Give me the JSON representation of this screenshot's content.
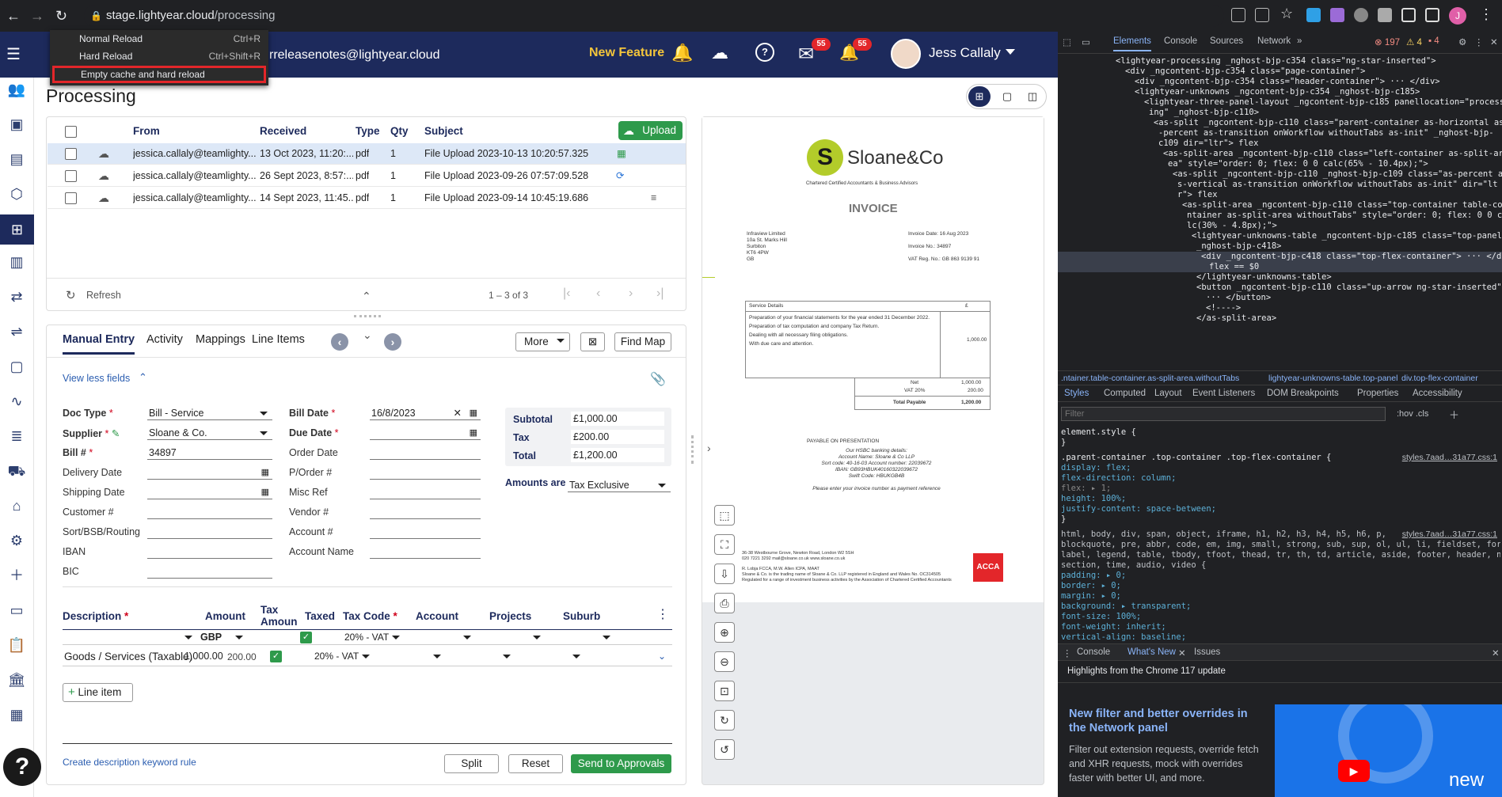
{
  "browser": {
    "url_host": "stage.lightyear.cloud",
    "url_path": "/processing",
    "avatar_initial": "J",
    "reload_menu": [
      {
        "label": "Normal Reload",
        "shortcut": "Ctrl+R"
      },
      {
        "label": "Hard Reload",
        "shortcut": "Ctrl+Shift+R"
      },
      {
        "label": "Empty cache and hard reload",
        "shortcut": ""
      }
    ]
  },
  "header": {
    "email_partial": "rreleasenotes@lightyear.cloud",
    "new_feature": "New Feature",
    "mail_count": "55",
    "notif_count": "55",
    "user_name": "Jess Callaly"
  },
  "page": {
    "title": "Processing"
  },
  "table": {
    "headers": [
      "From",
      "Received",
      "Type",
      "Qty",
      "Subject"
    ],
    "upload_label": "Upload",
    "rows": [
      {
        "from": "jessica.callaly@teamlighty...",
        "received": "13 Oct 2023, 11:20:...",
        "type": "pdf",
        "qty": "1",
        "subject": "File Upload 2023-10-13 10:20:57.325"
      },
      {
        "from": "jessica.callaly@teamlighty...",
        "received": "26 Sept 2023, 8:57:...",
        "type": "pdf",
        "qty": "1",
        "subject": "File Upload 2023-09-26 07:57:09.528"
      },
      {
        "from": "jessica.callaly@teamlighty...",
        "received": "14 Sept 2023, 11:45...",
        "type": "pdf",
        "qty": "1",
        "subject": "File Upload 2023-09-14 10:45:19.686"
      }
    ],
    "refresh_label": "Refresh",
    "pagination": "1 – 3 of 3"
  },
  "entry": {
    "tabs": [
      "Manual Entry",
      "Activity",
      "Mappings",
      "Line Items"
    ],
    "more_label": "More",
    "find_map_label": "Find Map",
    "view_less": "View less fields",
    "fields_left": [
      {
        "label": "Doc Type",
        "required": true,
        "value": "Bill - Service"
      },
      {
        "label": "Supplier",
        "required": true,
        "value": "Sloane & Co."
      },
      {
        "label": "Bill #",
        "required": true,
        "value": "34897"
      },
      {
        "label": "Delivery Date",
        "required": false,
        "value": ""
      },
      {
        "label": "Shipping Date",
        "required": false,
        "value": ""
      },
      {
        "label": "Customer #",
        "required": false,
        "value": ""
      },
      {
        "label": "Sort/BSB/Routing",
        "required": false,
        "value": ""
      },
      {
        "label": "IBAN",
        "required": false,
        "value": ""
      },
      {
        "label": "BIC",
        "required": false,
        "value": ""
      }
    ],
    "fields_mid": [
      {
        "label": "Bill Date",
        "required": true,
        "value": "16/8/2023"
      },
      {
        "label": "Due Date",
        "required": true,
        "value": ""
      },
      {
        "label": "Order Date",
        "required": false,
        "value": ""
      },
      {
        "label": "P/Order #",
        "required": false,
        "value": ""
      },
      {
        "label": "Misc Ref",
        "required": false,
        "value": ""
      },
      {
        "label": "Vendor #",
        "required": false,
        "value": ""
      },
      {
        "label": "Account #",
        "required": false,
        "value": ""
      },
      {
        "label": "Account Name",
        "required": false,
        "value": ""
      }
    ],
    "totals": [
      {
        "label": "Subtotal",
        "value": "£1,000.00"
      },
      {
        "label": "Tax",
        "value": "£200.00"
      },
      {
        "label": "Total",
        "value": "£1,200.00"
      }
    ],
    "amounts_are_label": "Amounts are",
    "amounts_are_value": "Tax Exclusive",
    "line_headers": {
      "description": "Description",
      "amount": "Amount",
      "tax_amount": "Tax Amoun",
      "taxed": "Taxed",
      "tax_code": "Tax Code",
      "account": "Account",
      "projects": "Projects",
      "suburb": "Suburb"
    },
    "currency": "GBP",
    "filter_tax_code": "20% - VAT",
    "line": {
      "description": "Goods / Services (Taxable)",
      "amount": "1,000.00",
      "tax_amount": "200.00",
      "tax_code": "20% - VAT"
    },
    "add_line_label": "Line item",
    "keyword_rule_link": "Create description keyword rule",
    "split_label": "Split",
    "reset_label": "Reset",
    "send_label": "Send to Approvals"
  },
  "invoice": {
    "company": "Sloane&Co",
    "tagline": "Chartered Certified Accountants & Business Advisors",
    "title": "INVOICE",
    "address": [
      "Infraview Limited",
      "10a St. Marks Hill",
      "Surbiton",
      "KT6 4PW",
      "GB"
    ],
    "invoice_date": "Invoice Date:  16 Aug 2023",
    "invoice_no": "Invoice No.:    34897",
    "vat_reg": "VAT Reg. No.:  GB 863 9139 91",
    "service_header": "Service Details",
    "currency_symbol": "£",
    "services": [
      "Preparation of your financial statements for the year ended 31 December 2022.",
      "Preparation of tax computation and company Tax Return.",
      "Dealing with all necessary filing obligations.",
      "With due care and attention."
    ],
    "service_amount": "1,000.00",
    "net_label": "Net",
    "net": "1,000.00",
    "vat_label": "VAT 20%",
    "vat": "200.00",
    "total_label": "Total Payable",
    "total": "1,200.00",
    "payable": "PAYABLE ON PRESENTATION",
    "bank_lines": [
      "Our HSBC banking details:",
      "Account Name: Sloane & Co LLP",
      "Sort code: 40-16-03  Account number: 22039672",
      "IBAN: GB93HBUK40160322039672",
      "Swift Code: HBUKGB4B"
    ],
    "ref_note": "Please enter your invoice number as payment reference",
    "footer_address": "36-38 Westbourne Grove, Newton Road, London W2 5SH",
    "footer_contact": "020 7221 3292   mail@sloane.co.uk   www.sloane.co.uk",
    "footer_partners": "R. Lobja FCCA, M.W. Allen ICPA, MAAT",
    "footer_reg": "Sloane & Co. is the trading name of Sloane & Co. LLP registered in England and Wales No. OC314505",
    "footer_reg2": "Regulated for a range of investment business activities by the Association of Chartered Certified Accountants",
    "acca": "ACCA"
  },
  "devtools": {
    "tabs": [
      "Elements",
      "Console",
      "Sources",
      "Network"
    ],
    "errors": "197",
    "warnings": "4",
    "issues": "4",
    "dom_lines": [
      "<lightyear-processing _nghost-bjp-c354 class=\"ng-star-inserted\">",
      "<div _ngcontent-bjp-c354 class=\"page-container\">",
      "<div _ngcontent-bjp-c354 class=\"header-container\"> ··· </div>",
      "<lightyear-unknowns _ngcontent-bjp-c354 _nghost-bjp-c185>",
      "<lightyear-three-panel-layout _ngcontent-bjp-c185 panellocation=\"process",
      "ing\" _nghost-bjp-c110>",
      "<as-split _ngcontent-bjp-c110 class=\"parent-container as-horizontal as",
      "-percent as-transition onWorkflow withoutTabs as-init\" _nghost-bjp-",
      "c109 dir=\"ltr\"> flex",
      "<as-split-area _ngcontent-bjp-c110 class=\"left-container as-split-ar",
      "ea\" style=\"order: 0; flex: 0 0 calc(65% - 10.4px);\">",
      "<as-split _ngcontent-bjp-c110 _nghost-bjp-c109 class=\"as-percent a",
      "s-vertical as-transition onWorkflow withoutTabs as-init\" dir=\"lt",
      "r\"> flex",
      "<as-split-area _ngcontent-bjp-c110 class=\"top-container table-co",
      "ntainer as-split-area withoutTabs\" style=\"order: 0; flex: 0 0 ca",
      "lc(30% - 4.8px);\">",
      "<lightyear-unknowns-table _ngcontent-bjp-c185 class=\"top-panel\"",
      "_nghost-bjp-c418>",
      "<div _ngcontent-bjp-c418 class=\"top-flex-container\"> ··· </div>",
      "flex  == $0",
      "</lightyear-unknowns-table>",
      "<button _ngcontent-bjp-c110 class=\"up-arrow ng-star-inserted\">",
      "··· </button>",
      "<!---->",
      "</as-split-area>"
    ],
    "breadcrumb": [
      ".ntainer.table-container.as-split-area.withoutTabs",
      "lightyear-unknowns-table.top-panel",
      "div.top-flex-container"
    ],
    "style_tabs": [
      "Styles",
      "Computed",
      "Layout",
      "Event Listeners",
      "DOM Breakpoints",
      "Properties",
      "Accessibility"
    ],
    "filter_placeholder": "Filter",
    "hov_cls": ":hov  .cls",
    "css_lines": [
      "element.style {",
      "}",
      ".parent-container .top-container .top-flex-container {",
      "  display: flex;",
      "  flex-direction: column;",
      "  flex: ▸ 1;",
      "  height: 100%;",
      "  justify-content: space-between;",
      "}",
      "html, body, div, span, object, iframe, h1, h2, h3, h4, h5, h6, p,",
      "blockquote, pre, abbr, code, em, img, small, strong, sub, sup, ol, ul, li, fieldset, form,",
      "label, legend, table, tbody, tfoot, thead, tr, th, td, article, aside, footer, header, nav,",
      "section, time, audio, video {",
      "  padding: ▸ 0;",
      "  border: ▸ 0;",
      "  margin: ▸ 0;",
      "  background: ▸ transparent;",
      "  font-size: 100%;",
      "  font-weight: inherit;",
      "  vertical-align: baseline;"
    ],
    "css_source": "styles.7aad…31a77.css:1",
    "drawer_tabs": [
      "Console",
      "What's New",
      "Issues"
    ],
    "highlights": "Highlights from the Chrome 117 update",
    "news_title": "New filter and better overrides in the Network panel",
    "news_body": "Filter out extension requests, override fetch and XHR requests, mock with overrides faster with better UI, and more.",
    "video_label": "new"
  }
}
